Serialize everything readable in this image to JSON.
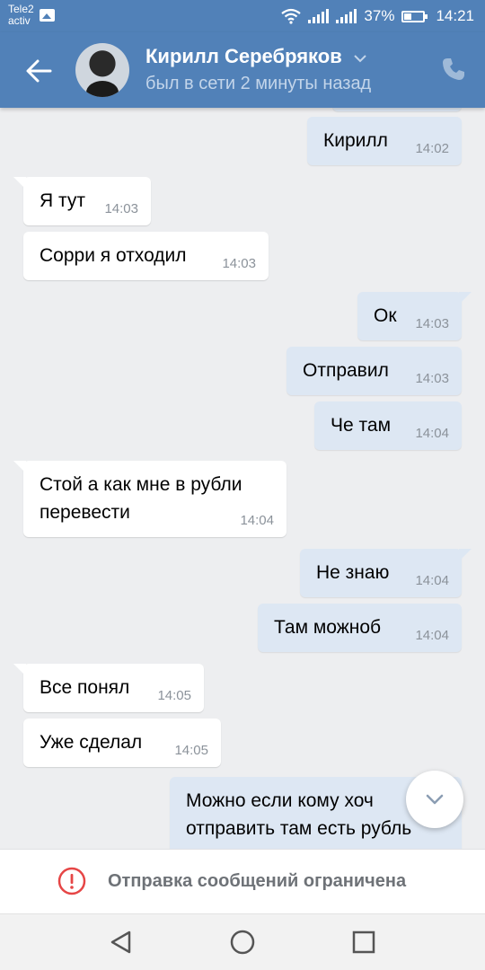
{
  "status_bar": {
    "carrier_line1": "Tele2",
    "carrier_line2": "activ",
    "battery": "37%",
    "time": "14:21",
    "icons": [
      "image-icon",
      "wifi-icon",
      "signal-icon",
      "signal-icon",
      "battery-icon"
    ]
  },
  "header": {
    "name": "Кирилл Серебряков",
    "last_seen": "был в сети 2 минуты назад",
    "icons": [
      "back-arrow-icon",
      "avatar",
      "chevron-down-icon",
      "phone-icon"
    ]
  },
  "messages": [
    {
      "dir": "out",
      "text": "Кирилл",
      "time": "14:02",
      "tail": false
    },
    {
      "dir": "in",
      "text": "Я тут",
      "time": "14:03",
      "tail": true
    },
    {
      "dir": "in",
      "text": "Сорри я отходил",
      "time": "14:03",
      "tail": false
    },
    {
      "dir": "out",
      "text": "Ок",
      "time": "14:03",
      "tail": true
    },
    {
      "dir": "out",
      "text": "Отправил",
      "time": "14:03",
      "tail": false
    },
    {
      "dir": "out",
      "text": "Че там",
      "time": "14:04",
      "tail": false
    },
    {
      "dir": "in",
      "text": "Стой а как мне в рубли\nперевести",
      "time": "14:04",
      "tail": true
    },
    {
      "dir": "out",
      "text": "Не знаю",
      "time": "14:04",
      "tail": true
    },
    {
      "dir": "out",
      "text": "Там можноб",
      "time": "14:04",
      "tail": false
    },
    {
      "dir": "in",
      "text": "Все понял",
      "time": "14:05",
      "tail": true
    },
    {
      "dir": "in",
      "text": "Уже сделал",
      "time": "14:05",
      "tail": false
    },
    {
      "dir": "out",
      "text": "Можно если кому хоч\nотправить там есть рубль",
      "time": "",
      "tail": true
    }
  ],
  "composer": {
    "restricted_text": "Отправка сообщений ограничена",
    "icon": "alert-circle-icon"
  },
  "colors": {
    "header": "#5181b8",
    "incoming_bubble": "#ffffff",
    "outgoing_bubble": "#dde7f3",
    "chat_background": "#edeef0",
    "alert": "#e64646"
  },
  "nav": [
    "back-triangle-icon",
    "home-circle-icon",
    "recents-square-icon"
  ]
}
